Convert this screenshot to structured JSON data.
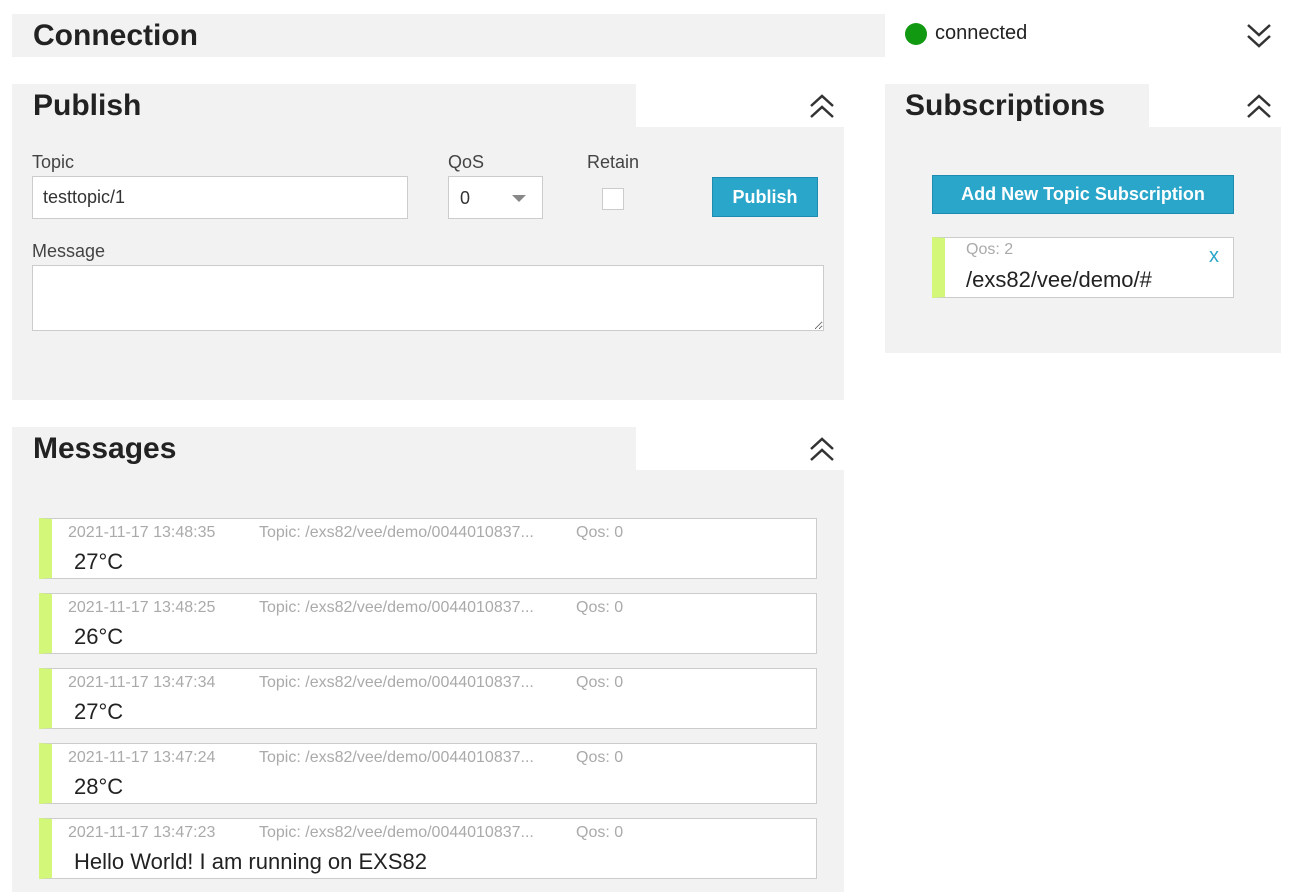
{
  "connection": {
    "title": "Connection",
    "status": "connected",
    "status_color": "#119911",
    "toggle_icon": "double-chevron-down"
  },
  "publish": {
    "title": "Publish",
    "topic_label": "Topic",
    "topic_value": "testtopic/1",
    "qos_label": "QoS",
    "qos_value": "0",
    "retain_label": "Retain",
    "retain_checked": false,
    "button": "Publish",
    "message_label": "Message",
    "message_value": "",
    "toggle_icon": "double-chevron-up"
  },
  "subscriptions": {
    "title": "Subscriptions",
    "add_button": "Add New Topic Subscription",
    "items": [
      {
        "qos": "Qos: 2",
        "topic": "/exs82/vee/demo/#",
        "remove": "x",
        "color": "#d2f779"
      }
    ]
  },
  "messages": {
    "title": "Messages",
    "items": [
      {
        "time": "2021-11-17 13:48:35",
        "topic": "Topic: /exs82/vee/demo/0044010837...",
        "qos": "Qos: 0",
        "text": "27°C"
      },
      {
        "time": "2021-11-17 13:48:25",
        "topic": "Topic: /exs82/vee/demo/0044010837...",
        "qos": "Qos: 0",
        "text": "26°C"
      },
      {
        "time": "2021-11-17 13:47:34",
        "topic": "Topic: /exs82/vee/demo/0044010837...",
        "qos": "Qos: 0",
        "text": "27°C"
      },
      {
        "time": "2021-11-17 13:47:24",
        "topic": "Topic: /exs82/vee/demo/0044010837...",
        "qos": "Qos: 0",
        "text": "28°C"
      },
      {
        "time": "2021-11-17 13:47:23",
        "topic": "Topic: /exs82/vee/demo/0044010837...",
        "qos": "Qos: 0",
        "text": "Hello World! I am running on EXS82"
      }
    ]
  },
  "colors": {
    "accent": "#2ba6cb",
    "panel": "#f2f2f2",
    "item_bar": "#d2f779"
  }
}
